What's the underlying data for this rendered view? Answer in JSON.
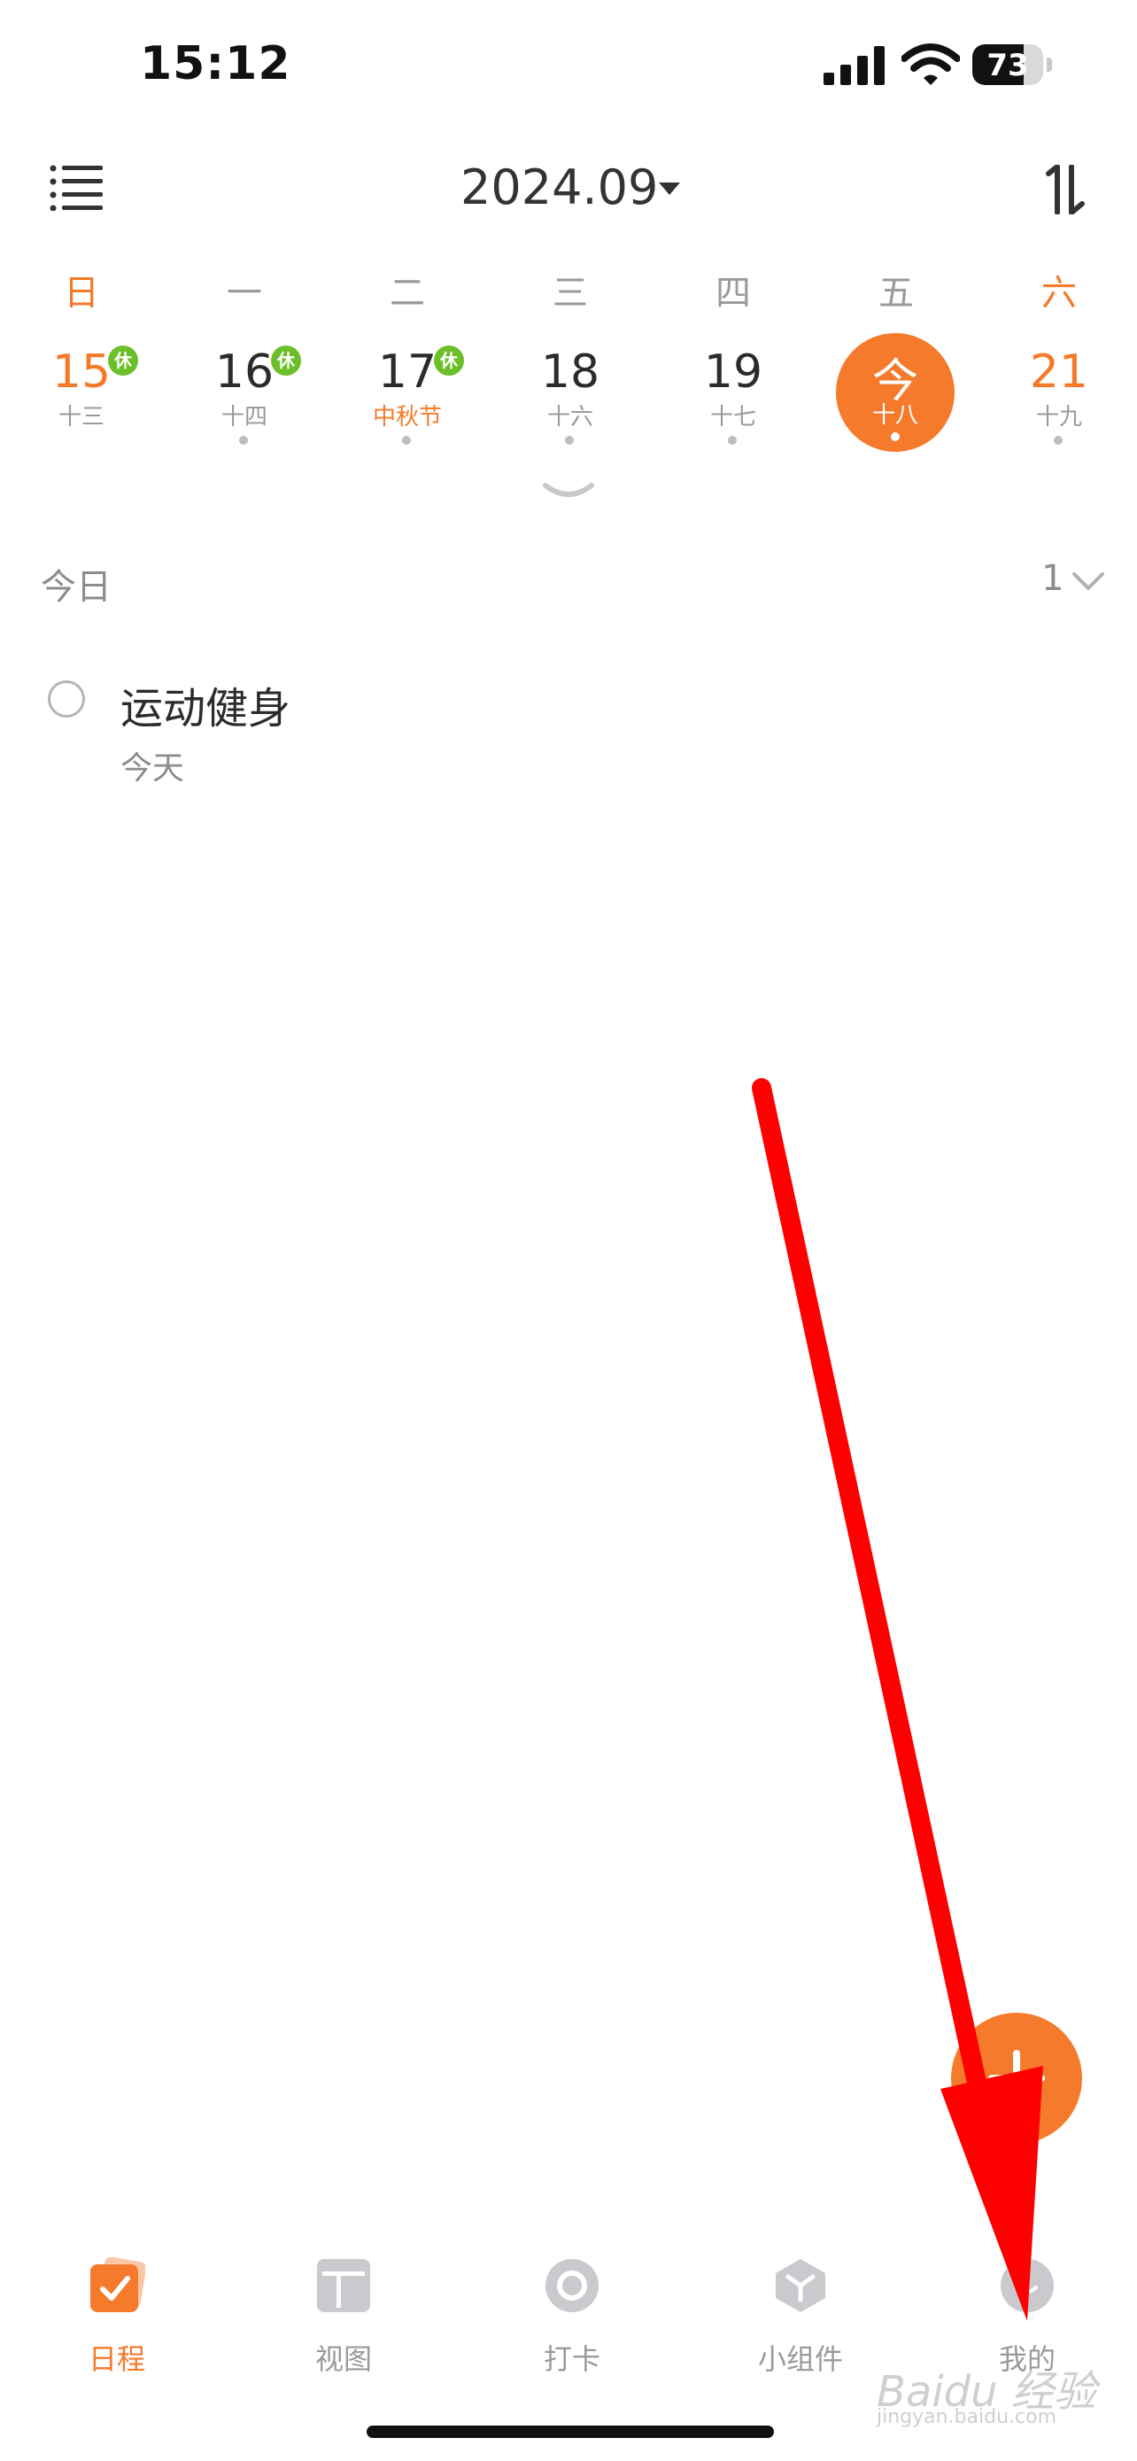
{
  "status_bar": {
    "time": "15:12",
    "battery": "73",
    "battery_level": 0.73
  },
  "header": {
    "month": "2024.09"
  },
  "week_days": [
    "日",
    "一",
    "二",
    "三",
    "四",
    "五",
    "六"
  ],
  "days": [
    {
      "num": "15",
      "lunar": "十三",
      "badge": "休"
    },
    {
      "num": "16",
      "lunar": "十四",
      "badge": "休"
    },
    {
      "num": "17",
      "lunar": "中秋节",
      "badge": "休"
    },
    {
      "num": "18",
      "lunar": "十六"
    },
    {
      "num": "19",
      "lunar": "十七"
    },
    {
      "num": "今",
      "lunar": "十八"
    },
    {
      "num": "21",
      "lunar": "十九"
    }
  ],
  "section": {
    "label": "今日",
    "count": "1"
  },
  "task": {
    "title": "运动健身",
    "date": "今天"
  },
  "tabs": [
    "日程",
    "视图",
    "打卡",
    "小组件",
    "我的"
  ],
  "watermark": {
    "text": "Baidu 经验",
    "sub": "jingyan.baidu.com"
  },
  "colors": {
    "accent": "#f57a2b",
    "holiday_badge": "#6cbf2a",
    "arrow": "#ff0000"
  }
}
